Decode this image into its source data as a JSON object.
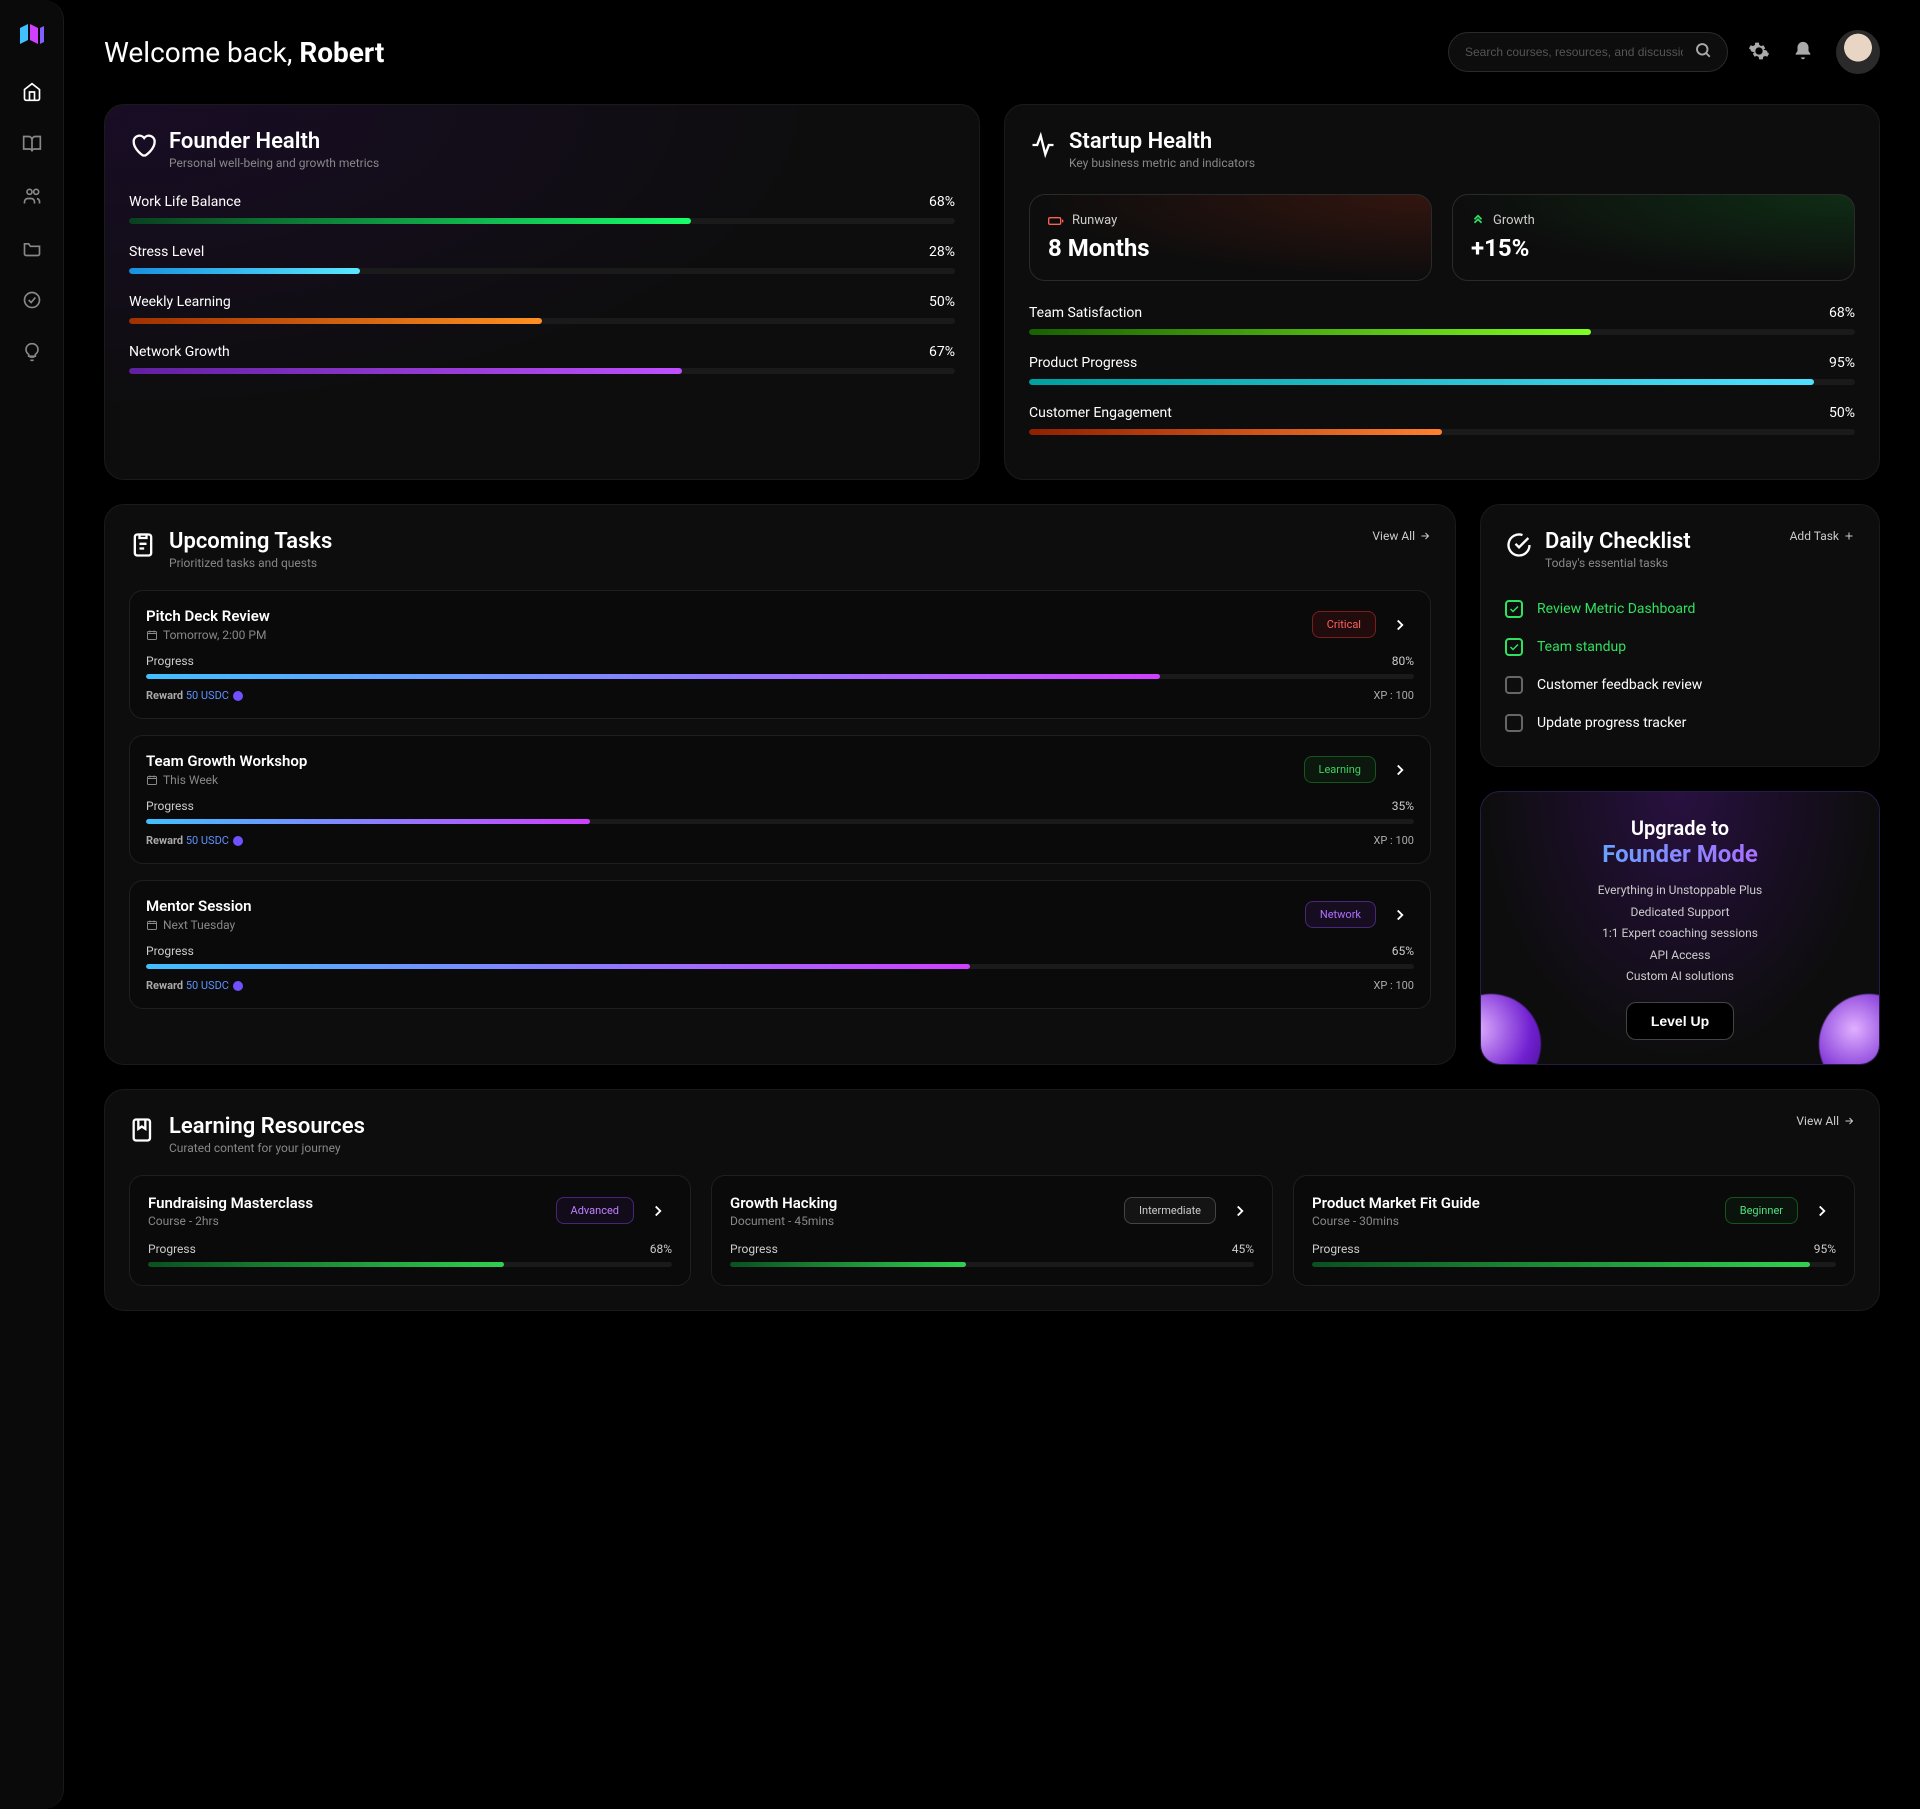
{
  "header": {
    "welcome_prefix": "Welcome back, ",
    "welcome_name": "Robert",
    "search_placeholder": "Search courses, resources, and discussions...."
  },
  "founder_health": {
    "title": "Founder Health",
    "subtitle": "Personal well-being and growth metrics",
    "metrics": [
      {
        "label": "Work Life Balance",
        "value": "68%",
        "pct": 68,
        "color": "green-grad"
      },
      {
        "label": "Stress Level",
        "value": "28%",
        "pct": 28,
        "color": "blue-light"
      },
      {
        "label": "Weekly Learning",
        "value": "50%",
        "pct": 50,
        "color": "orange-grad"
      },
      {
        "label": "Network Growth",
        "value": "67%",
        "pct": 67,
        "color": "purple-grad"
      }
    ]
  },
  "startup_health": {
    "title": "Startup Health",
    "subtitle": "Key business metric and indicators",
    "runway_label": "Runway",
    "runway_value": "8 Months",
    "growth_label": "Growth",
    "growth_value": "+15%",
    "metrics": [
      {
        "label": "Team Satisfaction",
        "value": "68%",
        "pct": 68,
        "color": "lime-grad"
      },
      {
        "label": "Product Progress",
        "value": "95%",
        "pct": 95,
        "color": "cyan-grad"
      },
      {
        "label": "Customer Engagement",
        "value": "50%",
        "pct": 50,
        "color": "orange2"
      }
    ]
  },
  "upcoming_tasks": {
    "title": "Upcoming Tasks",
    "subtitle": "Prioritized tasks and quests",
    "view_all": "View All",
    "tasks": [
      {
        "title": "Pitch Deck Review",
        "time": "Tomorrow, 2:00 PM",
        "badge": "Critical",
        "badge_cls": "critical",
        "progress_label": "Progress",
        "progress": "80%",
        "pct": 80,
        "reward_label": "Reward",
        "reward": "50 USDC",
        "xp": "XP : 100"
      },
      {
        "title": "Team Growth Workshop",
        "time": "This Week",
        "badge": "Learning",
        "badge_cls": "learning",
        "progress_label": "Progress",
        "progress": "35%",
        "pct": 35,
        "reward_label": "Reward",
        "reward": "50 USDC",
        "xp": "XP : 100"
      },
      {
        "title": "Mentor Session",
        "time": "Next Tuesday",
        "badge": "Network",
        "badge_cls": "network",
        "progress_label": "Progress",
        "progress": "65%",
        "pct": 65,
        "reward_label": "Reward",
        "reward": "50 USDC",
        "xp": "XP : 100"
      }
    ]
  },
  "daily_checklist": {
    "title": "Daily Checklist",
    "subtitle": "Today's essential tasks",
    "add_task": "Add Task",
    "items": [
      {
        "label": "Review Metric Dashboard",
        "done": true
      },
      {
        "label": "Team standup",
        "done": true
      },
      {
        "label": "Customer feedback review",
        "done": false
      },
      {
        "label": "Update progress tracker",
        "done": false
      }
    ]
  },
  "upgrade": {
    "line1": "Upgrade to",
    "line2": "Founder Mode",
    "features": [
      "Everything in Unstoppable Plus",
      "Dedicated Support",
      "1:1 Expert coaching sessions",
      "API Access",
      "Custom AI solutions"
    ],
    "cta": "Level Up"
  },
  "learning": {
    "title": "Learning Resources",
    "subtitle": "Curated content for your journey",
    "view_all": "View All",
    "resources": [
      {
        "title": "Fundraising Masterclass",
        "sub": "Course - 2hrs",
        "badge": "Advanced",
        "badge_cls": "advanced",
        "progress_label": "Progress",
        "progress": "68%",
        "pct": 68
      },
      {
        "title": "Growth Hacking",
        "sub": "Document - 45mins",
        "badge": "Intermediate",
        "badge_cls": "intermediate",
        "progress_label": "Progress",
        "progress": "45%",
        "pct": 45
      },
      {
        "title": "Product Market Fit Guide",
        "sub": "Course - 30mins",
        "badge": "Beginner",
        "badge_cls": "beginner",
        "progress_label": "Progress",
        "progress": "95%",
        "pct": 95
      }
    ]
  }
}
